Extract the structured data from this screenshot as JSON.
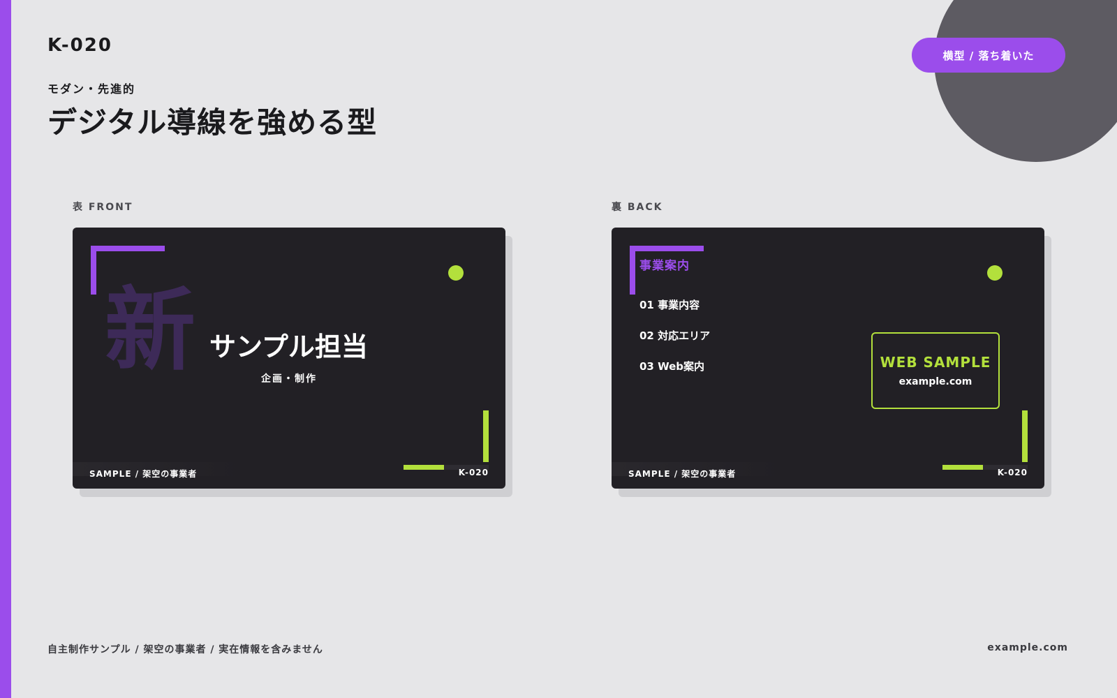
{
  "header": {
    "code": "K-020",
    "subtitle": "モダン・先進的",
    "title": "デジタル導線を強める型",
    "badge": "横型 / 落ち着いた"
  },
  "front": {
    "label": "表 FRONT",
    "kanji": "新",
    "person_name": "サンプル担当",
    "role": "企画・制作",
    "footer_left": "SAMPLE / 架空の事業者",
    "footer_right": "K-020"
  },
  "back": {
    "label": "裏 BACK",
    "section_title": "事業案内",
    "items": [
      "01 事業内容",
      "02 対応エリア",
      "03 Web案内"
    ],
    "web_label": "WEB SAMPLE",
    "web_url": "example.com",
    "footer_left": "SAMPLE / 架空の事業者",
    "footer_right": "K-020"
  },
  "footer": {
    "note": "自主制作サンプル / 架空の事業者 / 実在情報を含みません",
    "url": "example.com"
  },
  "colors": {
    "accent_purple": "#9b4deb",
    "accent_lime": "#b3e03c",
    "card_bg": "#222025",
    "page_bg": "#e6e6e8"
  }
}
